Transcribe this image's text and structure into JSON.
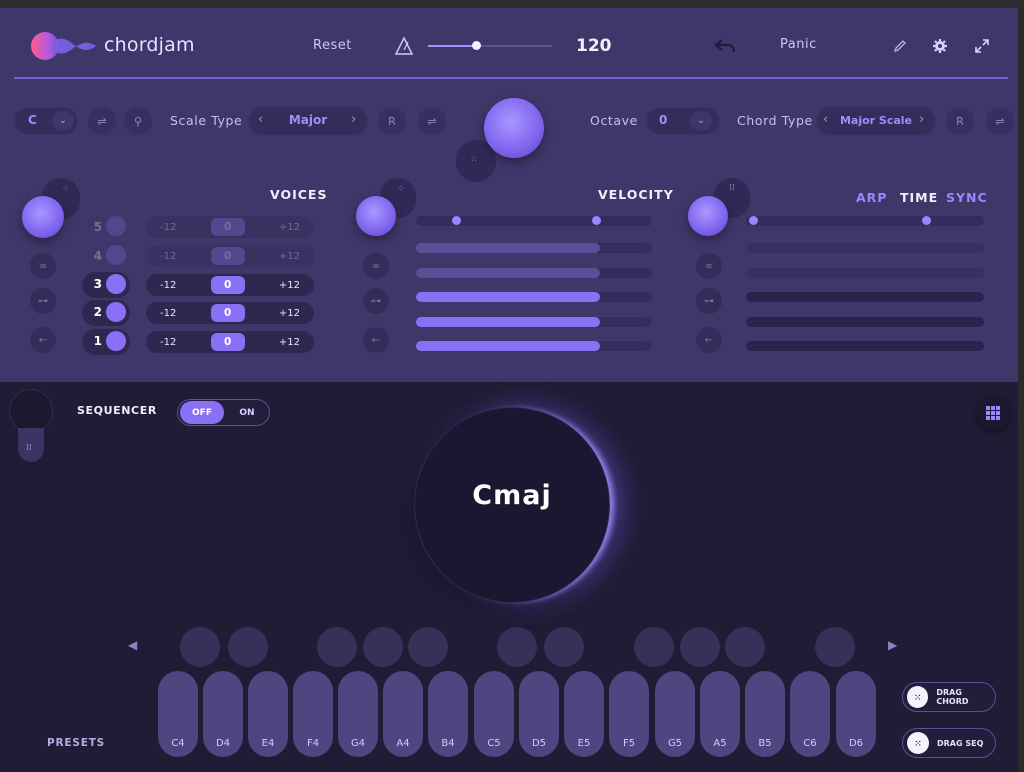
{
  "header": {
    "brand": "chordjam",
    "reset_label": "Reset",
    "tempo": "120",
    "panic_label": "Panic",
    "icons": [
      "metronome-icon",
      "undo-icon",
      "pencil-icon",
      "gear-icon",
      "resize-icon"
    ]
  },
  "controls": {
    "key": "C",
    "scale_type_label": "Scale Type",
    "scale_type_value": "Major",
    "octave_label": "Octave",
    "octave_value": "0",
    "chord_type_label": "Chord Type",
    "chord_type_value": "Major Scale",
    "r_label": "R"
  },
  "voices": {
    "title": "VOICES",
    "rows": [
      {
        "num": "5",
        "min": "-12",
        "value": "0",
        "max": "+12",
        "active": false
      },
      {
        "num": "4",
        "min": "-12",
        "value": "0",
        "max": "+12",
        "active": false
      },
      {
        "num": "3",
        "min": "-12",
        "value": "0",
        "max": "+12",
        "active": true
      },
      {
        "num": "2",
        "min": "-12",
        "value": "0",
        "max": "+12",
        "active": true
      },
      {
        "num": "1",
        "min": "-12",
        "value": "0",
        "max": "+12",
        "active": true
      }
    ]
  },
  "velocity": {
    "title": "VELOCITY",
    "bars": [
      0.78,
      0.78,
      0.78,
      0.78,
      0.78
    ]
  },
  "arp": {
    "arp_label": "ARP",
    "time_label": "TIME",
    "sync_label": "SYNC"
  },
  "sequencer": {
    "label": "SEQUENCER",
    "off_label": "OFF",
    "on_label": "ON"
  },
  "chord": {
    "name": "Cmaj"
  },
  "keyboard": {
    "white_keys": [
      "C4",
      "D4",
      "E4",
      "F4",
      "G4",
      "A4",
      "B4",
      "C5",
      "D5",
      "E5",
      "F5",
      "G5",
      "A5",
      "B5",
      "C6",
      "D6"
    ]
  },
  "footer": {
    "presets_label": "PRESETS",
    "drag_chord_label": "DRAG CHORD",
    "drag_seq_label": "DRAG SEQ"
  },
  "colors": {
    "accent": "#8a70f5",
    "panel": "#3e3769",
    "background": "#1f1c35"
  }
}
